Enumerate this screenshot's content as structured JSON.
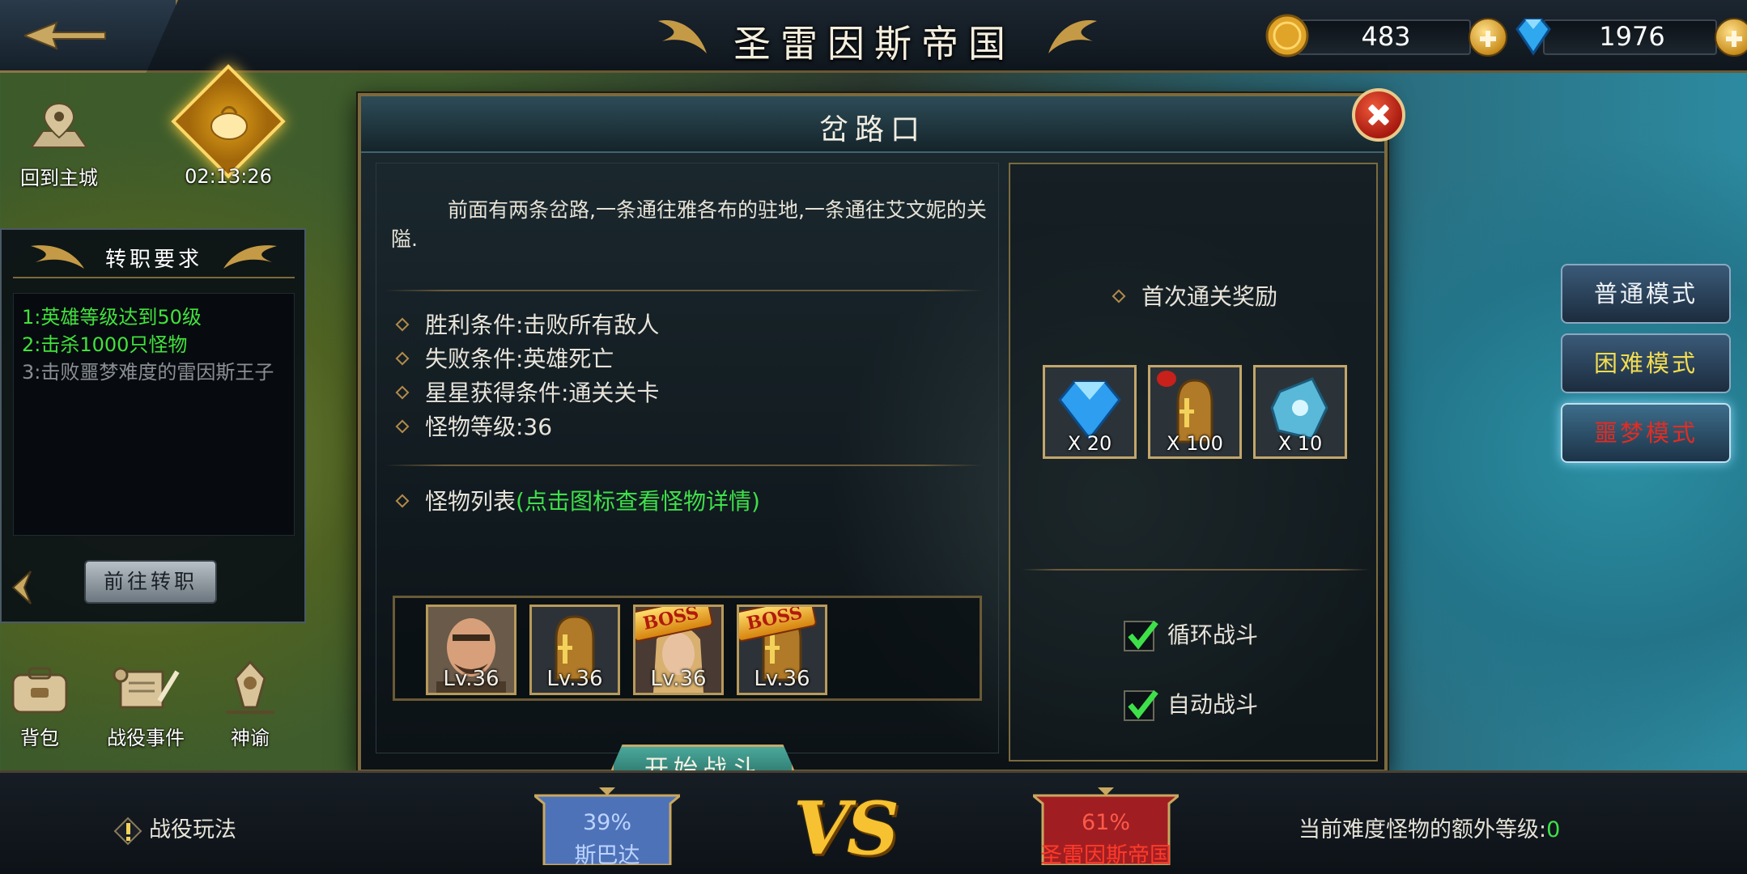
{
  "header": {
    "region_title": "圣雷因斯帝国",
    "gold": "483",
    "diamonds": "1976"
  },
  "left_panel": {
    "return_city_label": "回到主城",
    "timer": "02:13:26",
    "requirements_title": "转职要求",
    "requirements": [
      {
        "text": "1:英雄等级达到50级",
        "status": "done"
      },
      {
        "text": "2:击杀1000只怪物",
        "status": "done"
      },
      {
        "text": "3:击败噩梦难度的雷因斯王子",
        "status": "pending"
      }
    ],
    "goto_button": "前往转职",
    "bottom_icons": [
      {
        "label": "背包",
        "icon": "backpack-icon"
      },
      {
        "label": "战役事件",
        "icon": "scroll-icon"
      },
      {
        "label": "神谕",
        "icon": "oracle-icon"
      }
    ]
  },
  "dialog": {
    "title": "岔路口",
    "description": "前面有两条岔路,一条通往雅各布的驻地,一条通往艾文妮的关隘.",
    "conditions": [
      "胜利条件:击败所有敌人",
      "失败条件:英雄死亡",
      "星星获得条件:通关关卡",
      "怪物等级:36"
    ],
    "monster_list_label": "怪物列表",
    "monster_list_hint": "(点击图标查看怪物详情)",
    "monsters": [
      {
        "level": "Lv.36",
        "boss": false,
        "kind": "bandit"
      },
      {
        "level": "Lv.36",
        "boss": false,
        "kind": "bell"
      },
      {
        "level": "Lv.36",
        "boss": true,
        "kind": "woman"
      },
      {
        "level": "Lv.36",
        "boss": true,
        "kind": "bell"
      }
    ],
    "boss_tag": "BOSS",
    "start_button": "开始战斗",
    "first_clear_title": "首次通关奖励",
    "rewards": [
      {
        "qty": "X 20",
        "icon": "diamond-icon"
      },
      {
        "qty": "X 100",
        "icon": "bell-item-icon"
      },
      {
        "qty": "X 10",
        "icon": "crystal-icon"
      }
    ],
    "loop_battle": {
      "label": "循环战斗",
      "checked": true
    },
    "auto_battle": {
      "label": "自动战斗",
      "checked": true
    }
  },
  "modes": {
    "normal": "普通模式",
    "hard": "困难模式",
    "nightmare": "噩梦模式",
    "selected": "nightmare"
  },
  "footer": {
    "gameplay_label": "战役玩法",
    "left_side": {
      "percent": "39%",
      "name": "斯巴达"
    },
    "vs": "VS",
    "right_side": {
      "percent": "61%",
      "name": "圣雷因斯帝国"
    },
    "extra_level_label": "当前难度怪物的额外等级:",
    "extra_level_value": "0"
  },
  "colors": {
    "accent_gold": "#c8a860",
    "done_green": "#41e23c",
    "hint_green": "#3ee04a",
    "nightmare_red": "#e32c22",
    "hard_yellow": "#f3dc50",
    "blue_side": "#4e72b8",
    "red_side": "#c0262a"
  }
}
